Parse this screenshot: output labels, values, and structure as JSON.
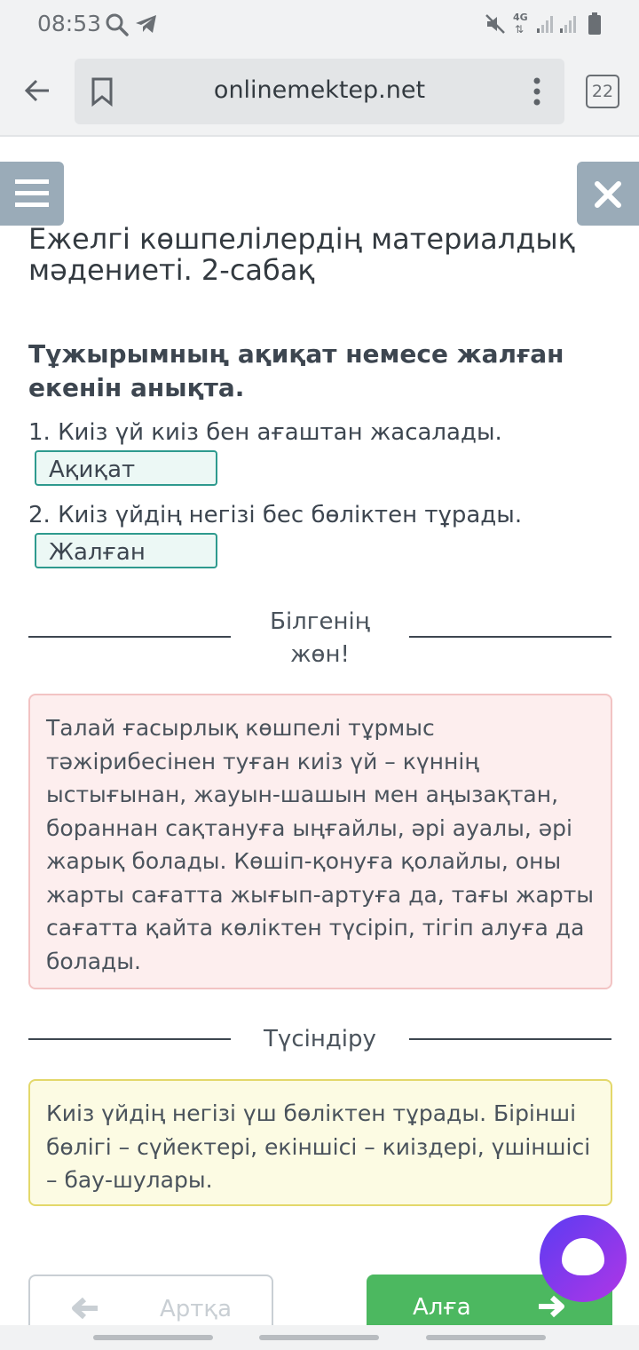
{
  "status_bar": {
    "time": "08:53",
    "icons": [
      "search-icon",
      "telegram-icon",
      "mute-icon",
      "network-4g-icon",
      "signal-icon",
      "signal-icon",
      "battery-icon"
    ],
    "network_label": "4G"
  },
  "browser": {
    "url": "onlinemektep.net",
    "tab_count": "22"
  },
  "page": {
    "title": "Ежелгі көшпелілердің материалдық мәдениеті. 2-сабақ",
    "question": "Тұжырымның ақиқат немесе жалған екенін анықта.",
    "statements": [
      {
        "text": "1. Киіз үй киіз бен ағаштан жасалады.",
        "answer": "Ақиқат"
      },
      {
        "text": "2. Киіз үйдің негізі бес бөліктен тұрады.",
        "answer": "Жалған"
      }
    ],
    "fact_heading_line1": "Білгенің",
    "fact_heading_line2": "жөн!",
    "fact_text": "Талай ғасырлық көшпелі тұрмыс тәжірибесінен туған киіз үй – күннің ыстығынан, жауын-шашын мен аңызақтан, бораннан сақтануға ыңғайлы, әрі ауалы, әрі жарық болады. Көшіп-қонуға қолайлы, оны жарты сағатта жығып-артуға да, тағы жарты сағатта қайта көліктен түсіріп, тігіп алуға да болады.",
    "explain_heading": "Түсіндіру",
    "explain_text": "Киіз үйдің негізі үш бөліктен тұрады. Бірінші бөлігі – сүйектері, екіншісі – киіздері, үшіншісі – бау-шулары."
  },
  "navigation": {
    "back_label": "Артқа",
    "next_label": "Алға"
  },
  "colors": {
    "accent_grey": "#9aabb8",
    "answer_border": "#2e9a8e",
    "fact_bg": "#fdeeee",
    "explain_bg": "#fcfbe3",
    "next_green": "#4cb860"
  }
}
